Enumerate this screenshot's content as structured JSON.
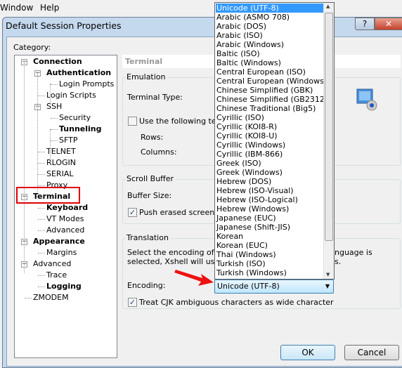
{
  "menubar": {
    "items": [
      "Window",
      "Help"
    ]
  },
  "dialog": {
    "title": "Default Session Properties",
    "help_label": "?",
    "close_label": "✕"
  },
  "category_label": "Category:",
  "tree": [
    {
      "label": "Connection",
      "bold": true,
      "level": 0,
      "exp": "−"
    },
    {
      "label": "Authentication",
      "bold": true,
      "level": 1,
      "exp": "−"
    },
    {
      "label": "Login Prompts",
      "level": 2
    },
    {
      "label": "Login Scripts",
      "level": 1
    },
    {
      "label": "SSH",
      "level": 1,
      "exp": "−"
    },
    {
      "label": "Security",
      "level": 2
    },
    {
      "label": "Tunneling",
      "bold": true,
      "level": 2
    },
    {
      "label": "SFTP",
      "level": 2
    },
    {
      "label": "TELNET",
      "level": 1
    },
    {
      "label": "RLOGIN",
      "level": 1
    },
    {
      "label": "SERIAL",
      "level": 1
    },
    {
      "label": "Proxy",
      "level": 1
    },
    {
      "label": "Terminal",
      "bold": true,
      "level": 0,
      "exp": "−",
      "highlight": true
    },
    {
      "label": "Keyboard",
      "bold": true,
      "level": 1
    },
    {
      "label": "VT Modes",
      "level": 1
    },
    {
      "label": "Advanced",
      "level": 1
    },
    {
      "label": "Appearance",
      "bold": true,
      "level": 0,
      "exp": "−"
    },
    {
      "label": "Margins",
      "level": 1
    },
    {
      "label": "Advanced",
      "level": 0,
      "exp": "−"
    },
    {
      "label": "Trace",
      "level": 1
    },
    {
      "label": "Logging",
      "bold": true,
      "level": 1
    },
    {
      "label": "ZMODEM",
      "level": 0
    }
  ],
  "panel": {
    "header": "Terminal",
    "emulation": {
      "title": "Emulation",
      "terminal_type_label": "Terminal Type:",
      "use_following_label": "Use the following term",
      "use_following_checked": false,
      "rows_label": "Rows:",
      "columns_label": "Columns:"
    },
    "scroll_buffer": {
      "title": "Scroll Buffer",
      "buffer_size_label": "Buffer Size:",
      "push_erased_label": "Push erased screen int",
      "push_erased_checked": true
    },
    "translation": {
      "title": "Translation",
      "desc_line1": "Select the encoding of the",
      "desc_line1_end": "nguage is",
      "desc_line2": "selected, Xshell will use th",
      "desc_line2_end": "s.",
      "encoding_label": "Encoding:",
      "encoding_value": "Unicode (UTF-8)",
      "cjk_label": "Treat CJK ambiguous characters as wide character",
      "cjk_checked": true
    }
  },
  "dropdown_options": [
    "Unicode (UTF-8)",
    "Arabic (ASMO 708)",
    "Arabic (DOS)",
    "Arabic (ISO)",
    "Arabic (Windows)",
    "Baltic (ISO)",
    "Baltic (Windows)",
    "Central European (ISO)",
    "Central European (Windows)",
    "Chinese Simplified (GBK)",
    "Chinese Simplified (GB2312)",
    "Chinese Traditional (Big5)",
    "Cyrillic (ISO)",
    "Cyrillic (KOI8-R)",
    "Cyrillic (KOI8-U)",
    "Cyrillic (Windows)",
    "Cyrillic (IBM-866)",
    "Greek (ISO)",
    "Greek (Windows)",
    "Hebrew (DOS)",
    "Hebrew (ISO-Visual)",
    "Hebrew (ISO-Logical)",
    "Hebrew (Windows)",
    "Japanese (EUC)",
    "Japanese (Shift-JIS)",
    "Korean",
    "Korean (EUC)",
    "Thai (Windows)",
    "Turkish (ISO)",
    "Turkish (Windows)"
  ],
  "buttons": {
    "ok": "OK",
    "cancel": "Cancel"
  },
  "colors": {
    "selection": "#3399ff",
    "highlight_box": "#e00000",
    "arrow": "#ee1111"
  }
}
